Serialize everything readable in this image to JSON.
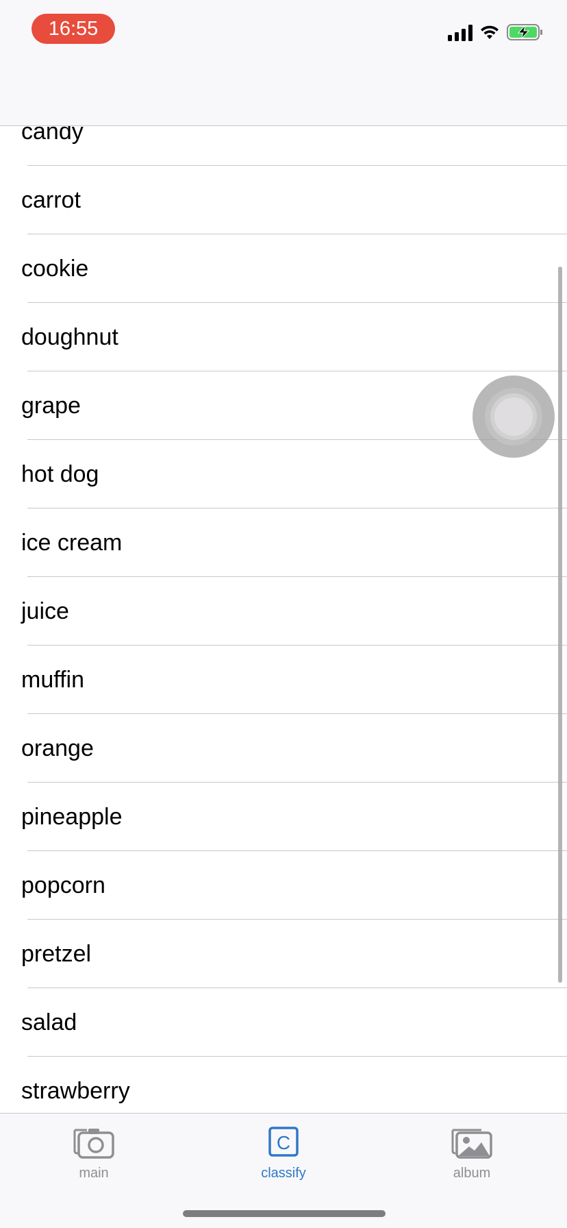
{
  "status_bar": {
    "time": "16:55",
    "icons": [
      "cellular-signal-icon",
      "wifi-icon",
      "battery-charging-icon"
    ],
    "colors": {
      "time_pill": "#e74c3c",
      "battery_fill": "#4cd964"
    }
  },
  "list": {
    "items": [
      "candy",
      "carrot",
      "cookie",
      "doughnut",
      "grape",
      "hot dog",
      "ice cream",
      "juice",
      "muffin",
      "orange",
      "pineapple",
      "popcorn",
      "pretzel",
      "salad",
      "strawberry"
    ]
  },
  "tab_bar": {
    "tabs": [
      {
        "label": "main",
        "icon": "camera-icon",
        "active": false
      },
      {
        "label": "classify",
        "icon": "classify-icon",
        "active": true
      },
      {
        "label": "album",
        "icon": "photo-album-icon",
        "active": false
      }
    ],
    "colors": {
      "active": "#2f78c8",
      "inactive": "#8e8e93"
    }
  }
}
